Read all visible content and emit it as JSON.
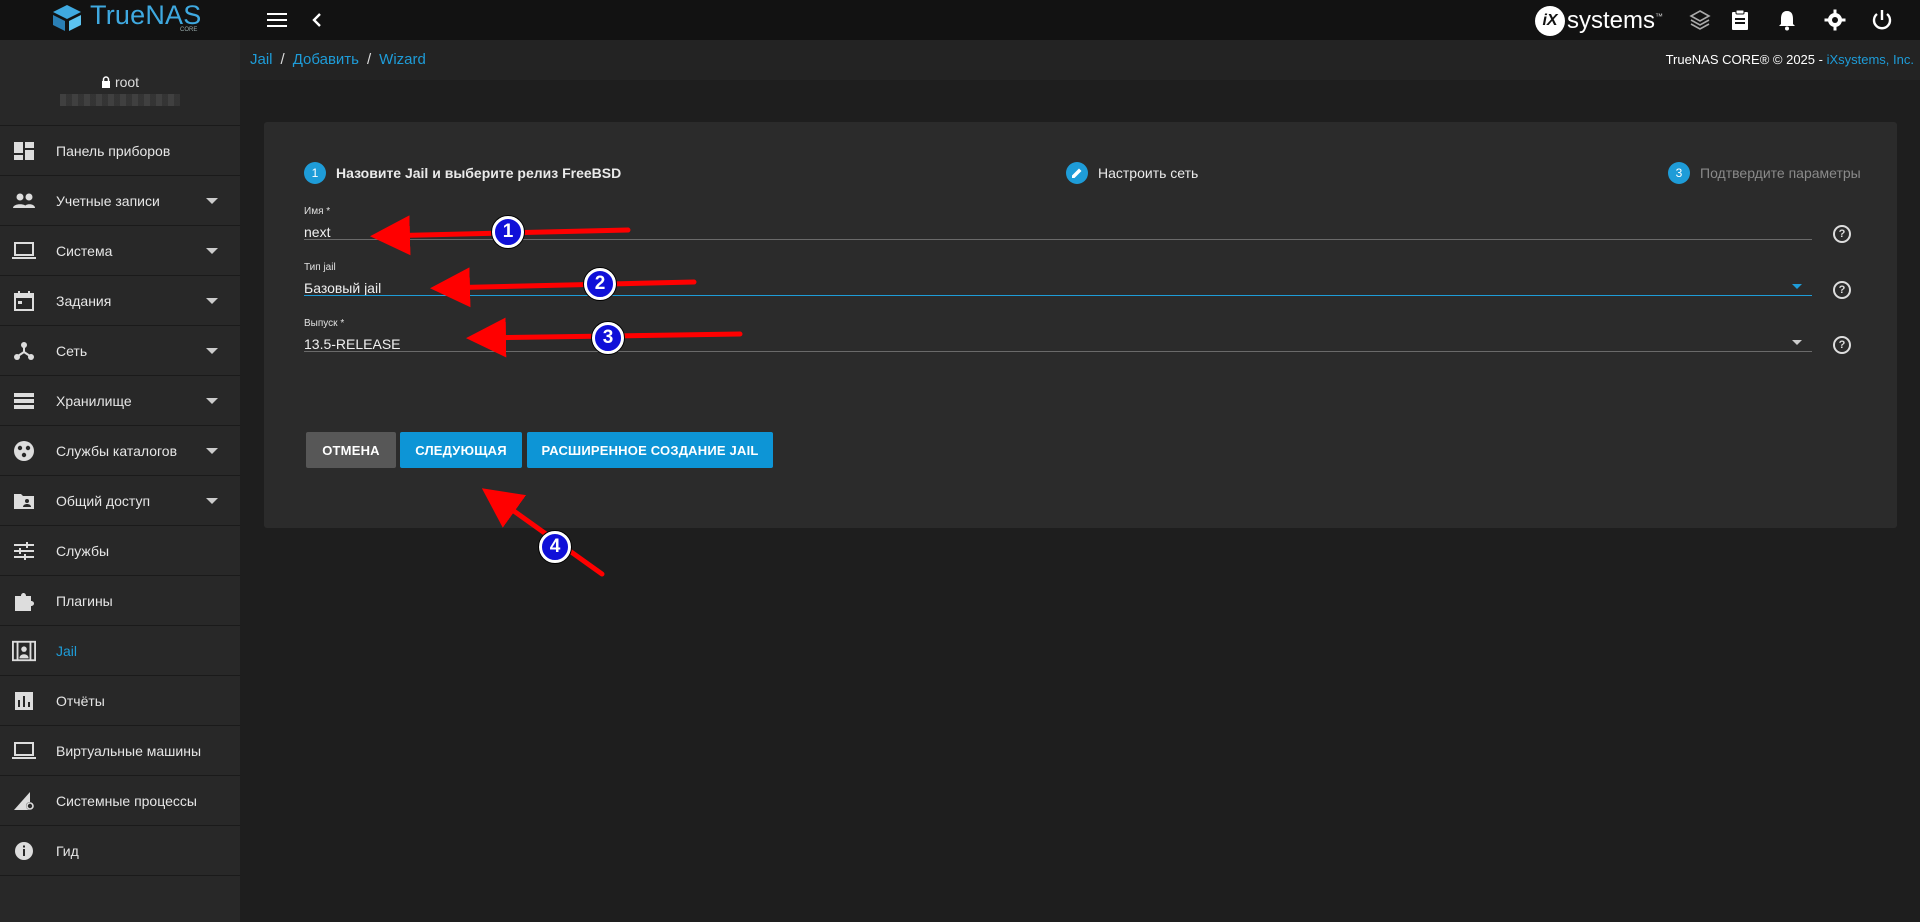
{
  "brand": {
    "name": "TrueNAS",
    "sub": "CORE",
    "vendor": "systems",
    "vendor_mark": "iX",
    "vendor_tm": "™"
  },
  "topbar": {
    "icons": [
      "menu-icon",
      "chevron-left-icon",
      "truecommand-icon",
      "clipboard-icon",
      "bell-icon",
      "gear-icon",
      "power-icon"
    ]
  },
  "user": {
    "name": "root"
  },
  "sidebar": {
    "items": [
      {
        "label": "Панель приборов",
        "icon": "dashboard-icon",
        "expandable": false
      },
      {
        "label": "Учетные записи",
        "icon": "accounts-icon",
        "expandable": true
      },
      {
        "label": "Система",
        "icon": "laptop-icon",
        "expandable": true
      },
      {
        "label": "Задания",
        "icon": "calendar-icon",
        "expandable": true
      },
      {
        "label": "Сеть",
        "icon": "network-icon",
        "expandable": true
      },
      {
        "label": "Хранилище",
        "icon": "storage-icon",
        "expandable": true
      },
      {
        "label": "Службы каталогов",
        "icon": "directory-icon",
        "expandable": true
      },
      {
        "label": "Общий доступ",
        "icon": "share-folder-icon",
        "expandable": true
      },
      {
        "label": "Службы",
        "icon": "tune-icon",
        "expandable": false
      },
      {
        "label": "Плагины",
        "icon": "puzzle-icon",
        "expandable": false
      },
      {
        "label": "Jail",
        "icon": "jail-icon",
        "expandable": false,
        "active": true
      },
      {
        "label": "Отчёты",
        "icon": "chart-icon",
        "expandable": false
      },
      {
        "label": "Виртуальные машины",
        "icon": "laptop-icon",
        "expandable": false
      },
      {
        "label": "Системные процессы",
        "icon": "processes-icon",
        "expandable": false
      },
      {
        "label": "Гид",
        "icon": "info-icon",
        "expandable": false
      }
    ]
  },
  "breadcrumb": {
    "items": [
      "Jail",
      "Добавить",
      "Wizard"
    ],
    "sep": "/"
  },
  "copyright": {
    "text": "TrueNAS CORE® © 2025 - ",
    "link": "iXsystems, Inc."
  },
  "stepper": {
    "steps": [
      {
        "num": "1",
        "label": "Назовите Jail и выберите релиз FreeBSD"
      },
      {
        "num": "",
        "label": "Настроить сеть"
      },
      {
        "num": "3",
        "label": "Подтвердите параметры"
      }
    ]
  },
  "form": {
    "name": {
      "label": "Имя *",
      "value": "next"
    },
    "jail_type": {
      "label": "Тип jail",
      "value": "Базовый jail"
    },
    "release": {
      "label": "Выпуск *",
      "value": "13.5-RELEASE"
    },
    "help_glyph": "?"
  },
  "buttons": {
    "cancel": "ОТМЕНА",
    "next": "СЛЕДУЮЩАЯ",
    "advanced": "РАСШИРЕННОЕ СОЗДАНИЕ JAIL"
  },
  "annotations": {
    "badges": [
      "1",
      "2",
      "3",
      "4"
    ],
    "arrow_color": "#ff0000",
    "badge_color": "#1010d8"
  },
  "colors": {
    "accent": "#1e9cd8",
    "topbar": "#121212",
    "sidebar": "#282828",
    "card": "#2b2b2b"
  }
}
